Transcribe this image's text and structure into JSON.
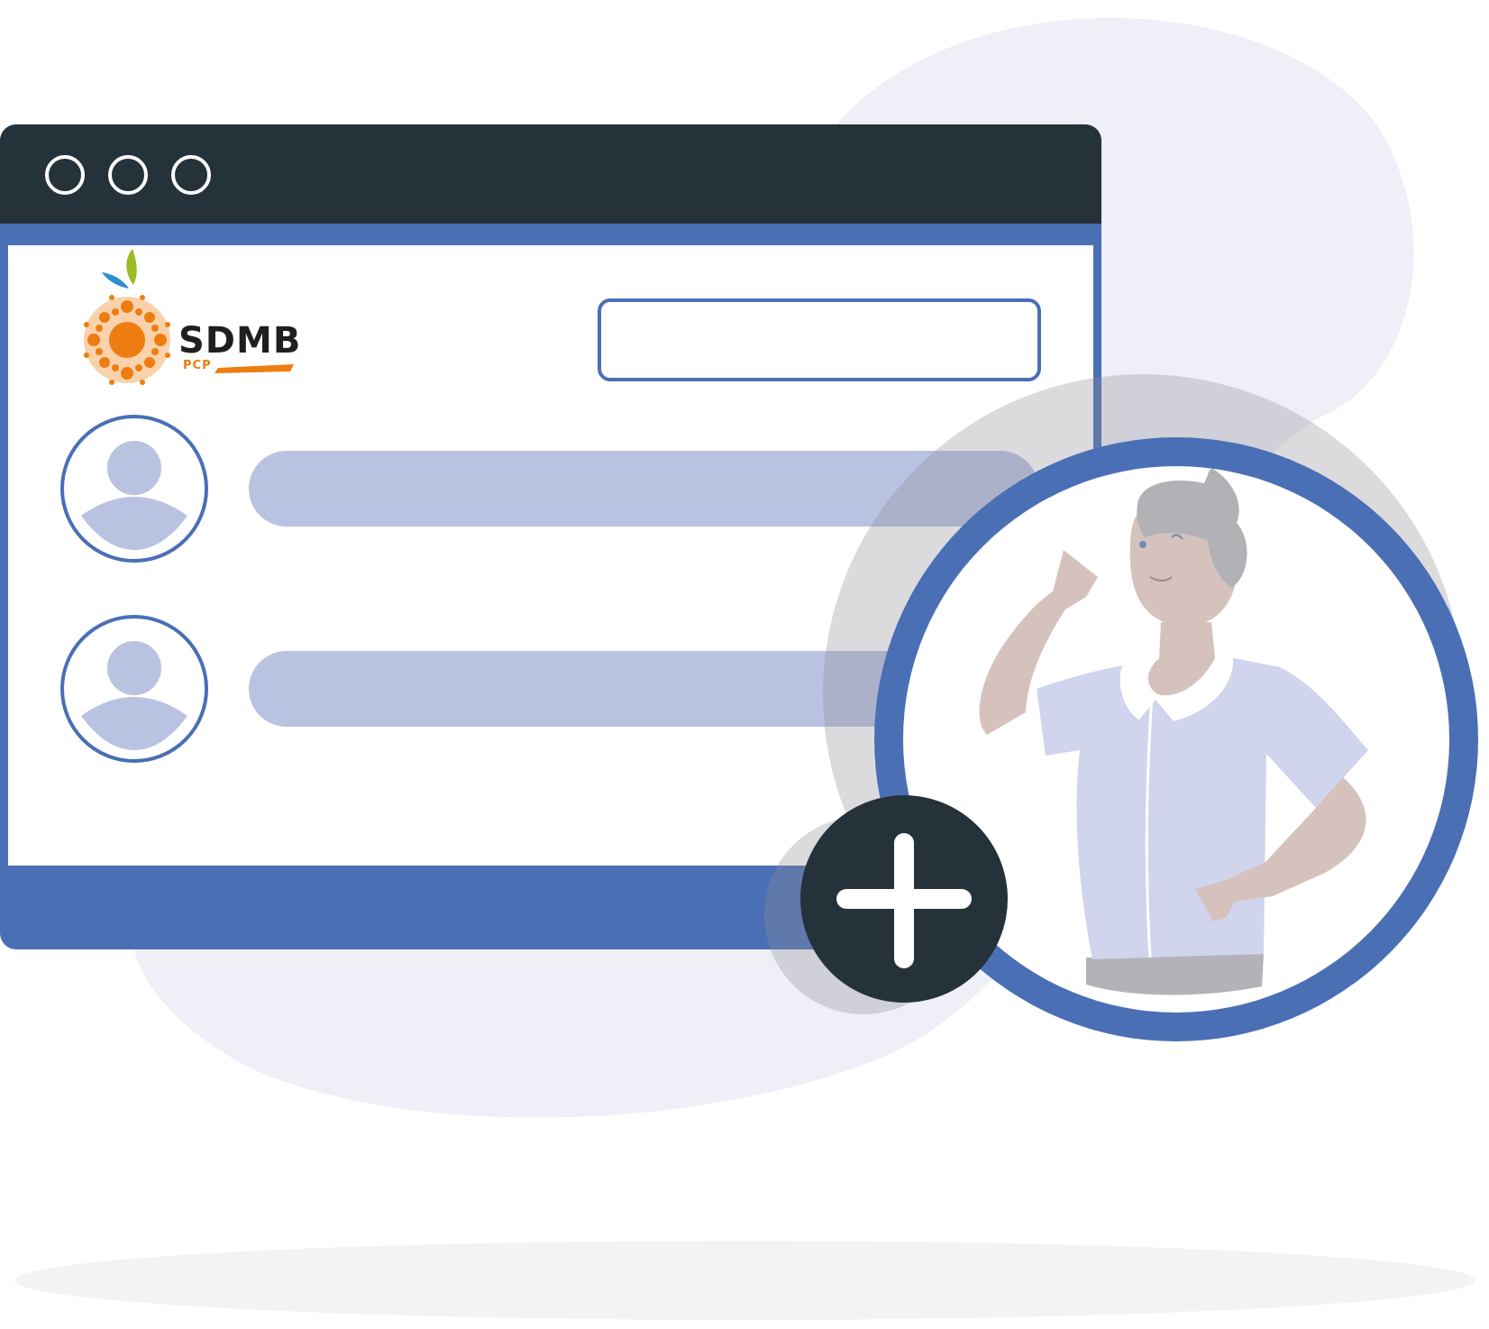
{
  "brand": {
    "name": "SDMB",
    "sub": "PCP",
    "primary_color": "#ee7d11",
    "leaf_colors": [
      "#9dbc23",
      "#2e8fcf"
    ]
  },
  "colors": {
    "titlebar": "#253239",
    "accent": "#4a6fb5",
    "placeholder_bar": "#bac2e2",
    "background_blob": "#eeeff7",
    "add_button": "#253239"
  },
  "window": {
    "controls": [
      "window-control-1",
      "window-control-2",
      "window-control-3"
    ]
  },
  "search": {
    "value": ""
  },
  "list": {
    "items": [
      {
        "icon": "user-avatar-icon"
      },
      {
        "icon": "user-avatar-icon"
      }
    ]
  },
  "add_button": {
    "icon": "plus-icon"
  }
}
